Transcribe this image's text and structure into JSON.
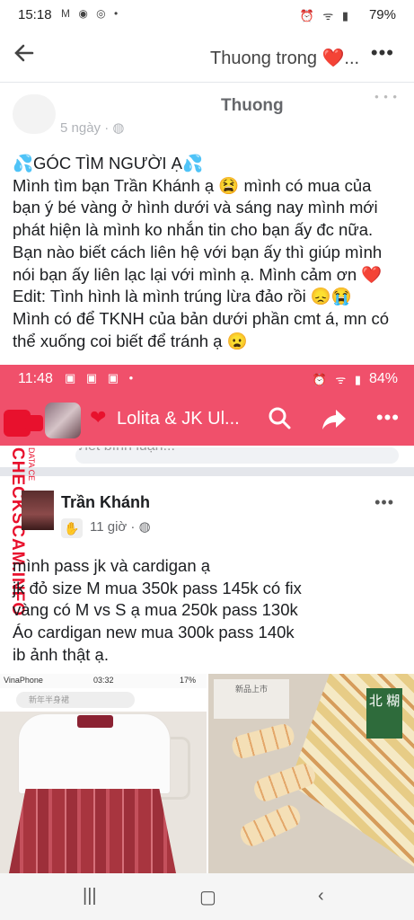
{
  "status_bar": {
    "time": "15:18",
    "battery": "79%"
  },
  "app_bar": {
    "title": "Thuong trong ❤️..."
  },
  "post": {
    "author": "Thuong",
    "time": "5 ngày ·",
    "lines": [
      "💦GÓC TÌM NGƯỜI Ạ💦",
      "Mình tìm bạn Trần Khánh ạ 😫 mình có mua của",
      "bạn ý bé vàng ở hình dưới và sáng nay mình mới",
      "phát hiện là mình ko nhắn tin cho bạn ấy đc nữa.",
      "Bạn nào biết cách liên hệ với bạn ấy thì giúp mình",
      "nói bạn ấy liên lạc lại với mình ạ. Mình cảm ơn ❤️",
      "Edit: Tình hình là mình trúng lừa đảo rồi 😞😭",
      "Mình có để TKNH của bản dưới phần cmt á, mn có",
      "thể xuống coi biết để tránh ạ 😦"
    ]
  },
  "screenshot": {
    "status_time": "11:48",
    "status_battery": "84%",
    "group_title": "Lolita & JK Ul...",
    "watermark": "CHECKSCAM.INFO",
    "watermark_small": "DATA CE",
    "post_author": "Trần Khánh",
    "post_time": "11 giờ ·",
    "post_lines": [
      "mình pass jk và cardigan ạ",
      "jk đỏ size M mua 350k pass 145k có fix",
      "vàng có M vs S ạ mua 250k pass 130k",
      "Áo cardigan new mua 300k pass 140k",
      "ib ảnh thật ạ."
    ],
    "photo1": {
      "carrier": "VinaPhone",
      "time": "03:32",
      "battery": "17%",
      "search_text": "新年半身裙"
    },
    "photo2": {
      "banner": "新品上市",
      "tag": "北 糊"
    }
  }
}
